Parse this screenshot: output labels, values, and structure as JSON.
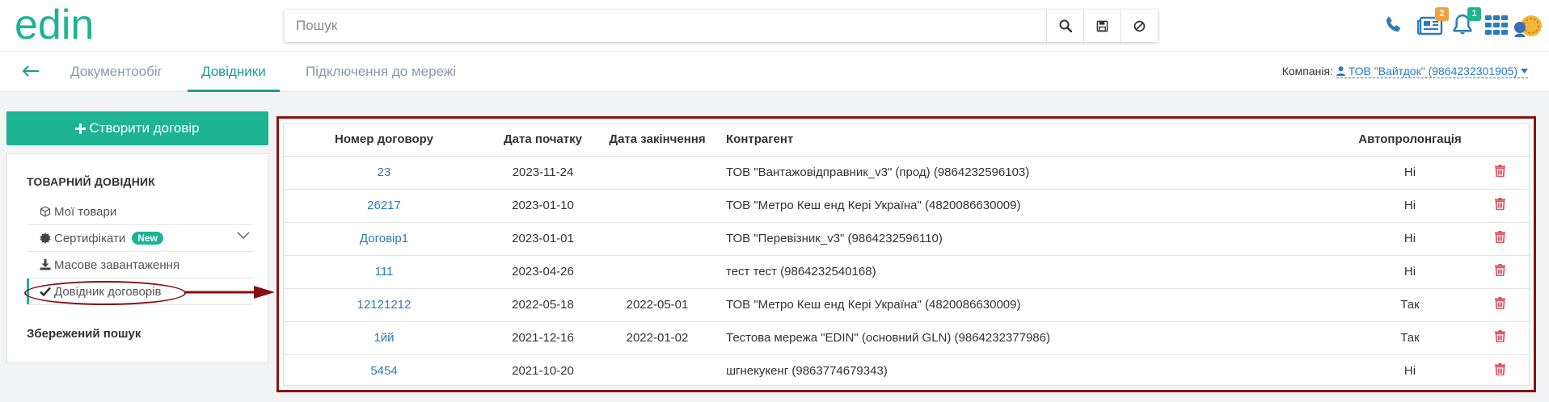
{
  "header": {
    "logo_text": "edin",
    "search_placeholder": "Пошук",
    "search_value": "",
    "icons": [
      "search-icon",
      "save-icon",
      "clear-icon",
      "phone-icon",
      "news-icon",
      "bell-icon",
      "apps-icon",
      "avatar"
    ],
    "news_badge": "2",
    "bell_badge": "1",
    "accent": "#1db393"
  },
  "tabs": {
    "items": [
      {
        "label": "Документообіг",
        "active": false
      },
      {
        "label": "Довідники",
        "active": true
      },
      {
        "label": "Підключення до мережі",
        "active": false
      }
    ],
    "company_label": "Компанія:",
    "company_value": "ТОВ \"Вайтдок\" (9864232301905)"
  },
  "sidebar": {
    "create_label": "Створити договір",
    "section_title": "ТОВАРНИЙ ДОВІДНИК",
    "items": [
      {
        "label": "Мої товари",
        "icon": "box-icon"
      },
      {
        "label": "Сертифікати",
        "icon": "certificate-icon",
        "badge": "New"
      },
      {
        "label": "Масове завантаження",
        "icon": "download-icon"
      },
      {
        "label": "Довідник договорів",
        "icon": "check-icon",
        "active": true
      }
    ],
    "saved_search": "Збережений пошук"
  },
  "table": {
    "columns": [
      "Номер договору",
      "Дата початку",
      "Дата закінчення",
      "Контрагент",
      "Автопролонгація",
      ""
    ],
    "rows": [
      {
        "number": "23",
        "start": "2023-11-24",
        "end": "",
        "counterparty": "ТОВ \"Вантажовідправник_v3\" (прод) (9864232596103)",
        "auto": "Ні"
      },
      {
        "number": "26217",
        "start": "2023-01-10",
        "end": "",
        "counterparty": "ТОВ \"Метро Кеш енд Кері Україна\" (4820086630009)",
        "auto": "Ні"
      },
      {
        "number": "Договір1",
        "start": "2023-01-01",
        "end": "",
        "counterparty": "ТОВ \"Перевізник_v3\" (9864232596110)",
        "auto": "Ні"
      },
      {
        "number": "111",
        "start": "2023-04-26",
        "end": "",
        "counterparty": "тест тест (9864232540168)",
        "auto": "Ні"
      },
      {
        "number": "12121212",
        "start": "2022-05-18",
        "end": "2022-05-01",
        "counterparty": "ТОВ \"Метро Кеш енд Кері Україна\" (4820086630009)",
        "auto": "Так"
      },
      {
        "number": "1йй",
        "start": "2021-12-16",
        "end": "2022-01-02",
        "counterparty": "Тестова мережа \"EDIN\" (основний GLN) (9864232377986)",
        "auto": "Так"
      },
      {
        "number": "5454",
        "start": "2021-10-20",
        "end": "",
        "counterparty": "шгнекукенг (9863774679343)",
        "auto": "Ні"
      }
    ]
  }
}
